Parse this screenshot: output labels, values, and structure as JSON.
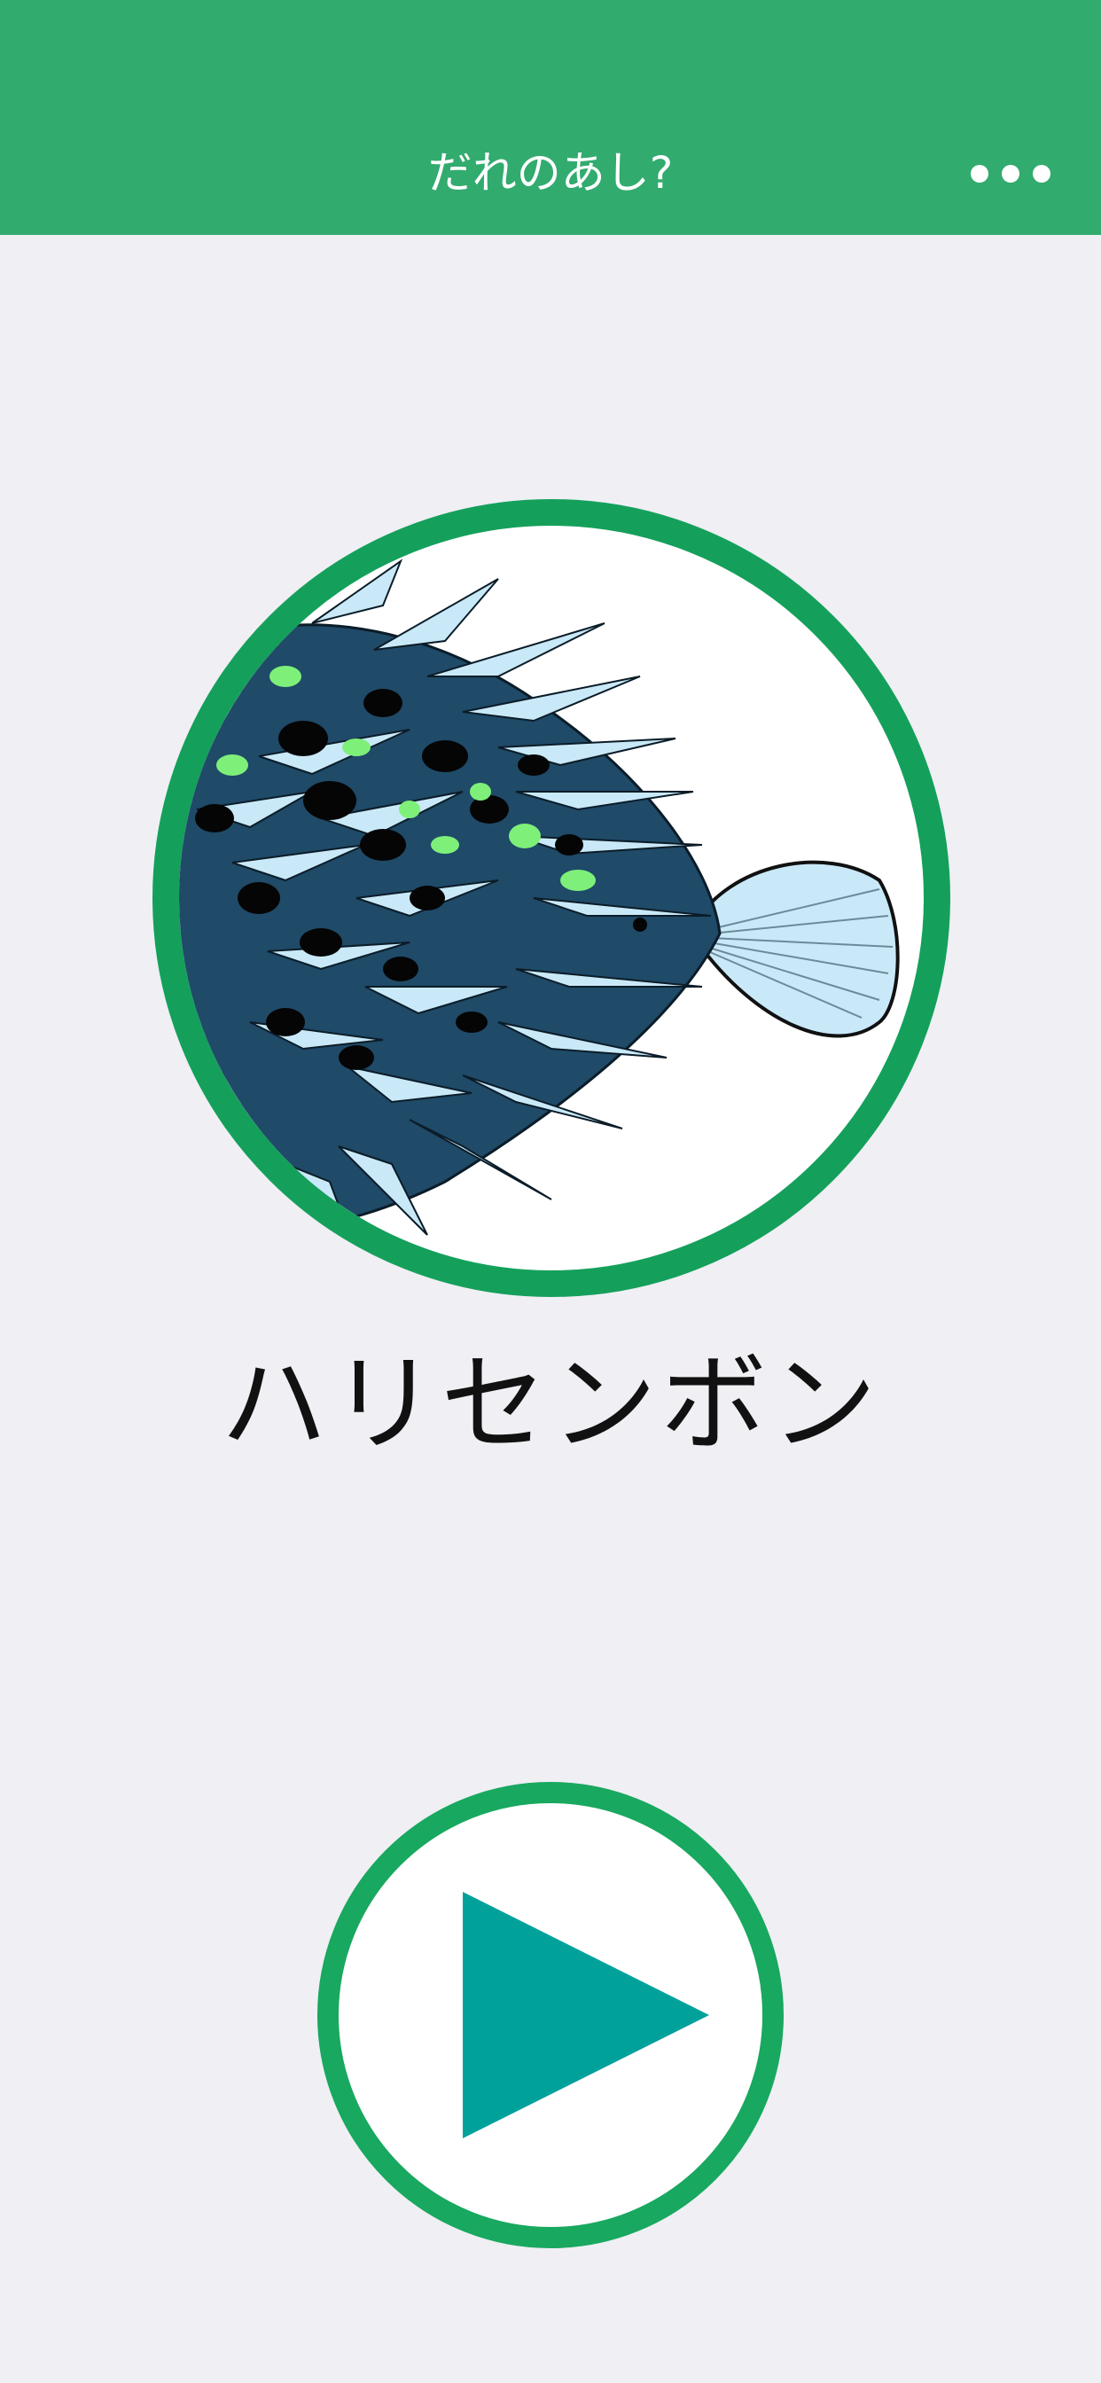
{
  "header": {
    "title": "だれのあし?",
    "menu_icon": "more-horizontal-icon"
  },
  "main": {
    "animal_name": "ハリセンボン",
    "illustration": "porcupinefish-illustration",
    "play_icon": "play-icon"
  },
  "colors": {
    "header_background": "#32ab6e",
    "ring": "#14a05b",
    "play_triangle": "#00a19a",
    "page_background": "#efeff4",
    "fish_body": "#1f4a68",
    "fish_spines": "#c9e9f8",
    "fish_spots_green": "#7ef07a"
  }
}
